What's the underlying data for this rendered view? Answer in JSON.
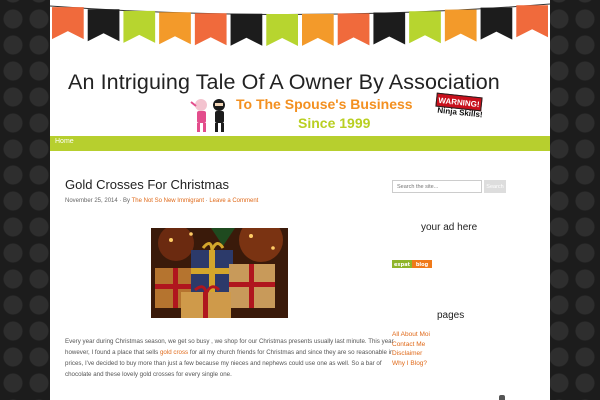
{
  "header": {
    "site_title": "An Intriguing Tale Of A Owner By Association",
    "tagline_line1": "To The Spouse's  Business",
    "tagline_line2": "Since 1999",
    "warning_label": "WARNING!",
    "ninja_skills_label": "Ninja Skills!",
    "bunting_colors": [
      "#f06a3c",
      "#1c1c1c",
      "#b7d52f",
      "#f39a2a",
      "#f06a3c",
      "#1c1c1c",
      "#b7d52f",
      "#f39a2a",
      "#f06a3c",
      "#1c1c1c",
      "#b7d52f",
      "#f39a2a",
      "#1c1c1c",
      "#f06a3c"
    ]
  },
  "nav": {
    "items": [
      {
        "label": "Home"
      }
    ],
    "accent_color": "#b7cf2e"
  },
  "post": {
    "title": "Gold Crosses For Christmas",
    "date": "November 25, 2014",
    "by_label": "By",
    "author": "The Not So New Immigrant",
    "comment_link": "Leave a Comment",
    "image_subject": "wrapped-christmas-presents",
    "body_before_link": "Every year during Christmas season, we get so busy , we shop for our Christmas presents usually last minute.  This year however, I found a place that sells ",
    "body_link": "gold cross",
    "body_after_link": " for all my church friends for Christmas and since they are so reasonable in prices, I've decided to buy more than just a few because my nieces and nephews could use one as well.  So a bar of chocolate and these lovely gold crosses for every single one."
  },
  "sidebar": {
    "search_placeholder": "Search the site...",
    "search_button": "Search",
    "ad_heading": "your ad here",
    "expat_badge_left": "expat",
    "expat_badge_right": "blog",
    "pages_heading": "pages",
    "pages": [
      {
        "label": "All About Moi"
      },
      {
        "label": "Contact Me"
      },
      {
        "label": "Disclaimer"
      },
      {
        "label": "Why I Blog?"
      }
    ]
  }
}
